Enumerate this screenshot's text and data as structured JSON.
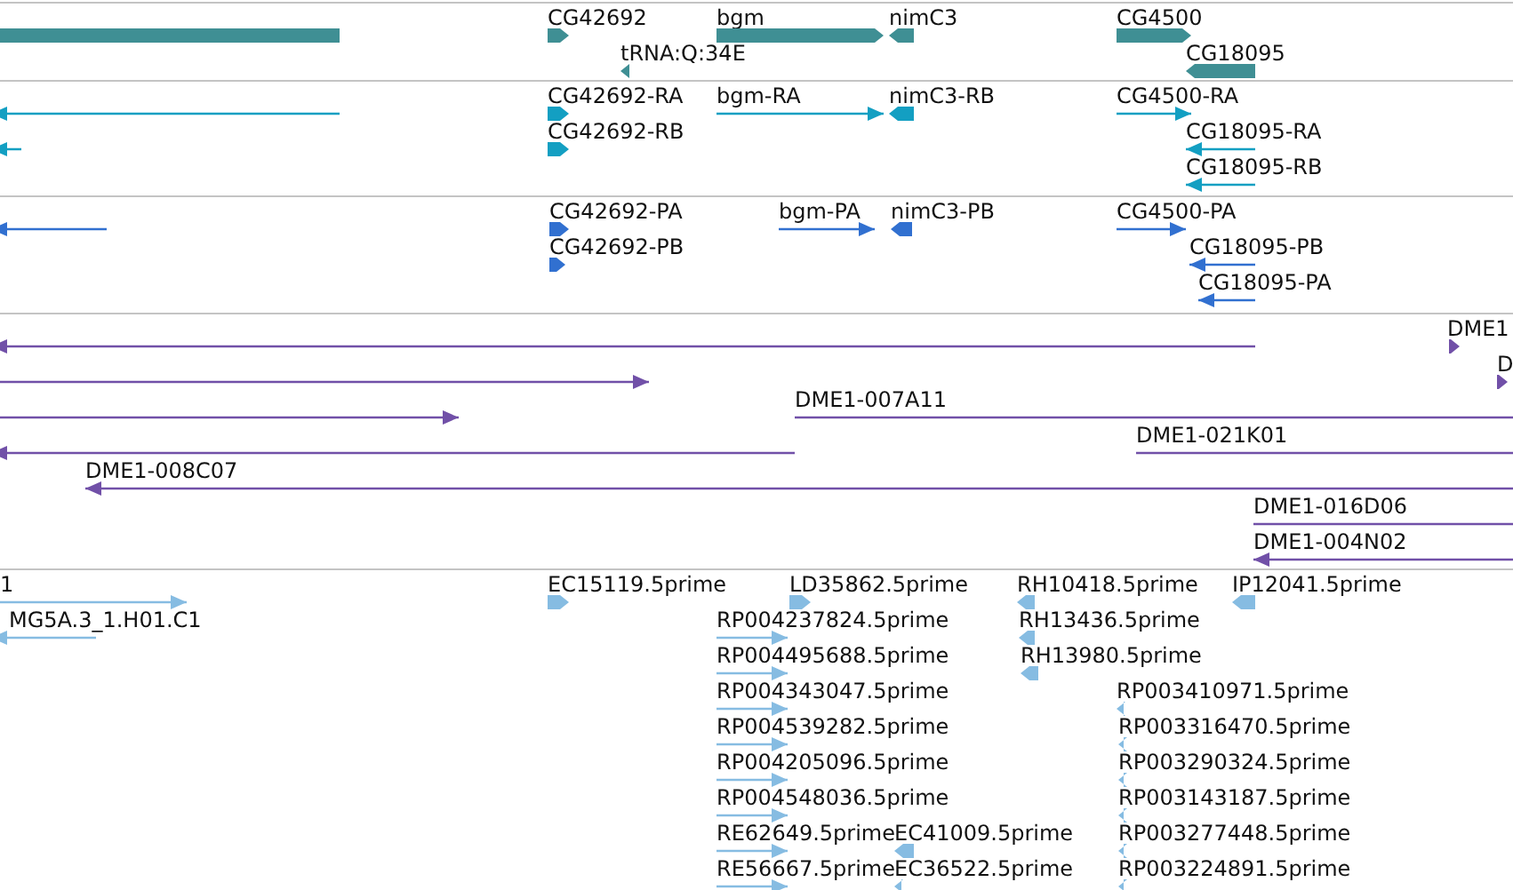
{
  "tracks": [
    {
      "color": "#3f8f94",
      "features": [
        {
          "kind": "block"
        },
        {
          "label": "CG42692",
          "kind": "forward"
        },
        {
          "label": "tRNA:Q:34E",
          "kind": "reverse"
        },
        {
          "label": "bgm",
          "kind": "forward"
        },
        {
          "label": "nimC3",
          "kind": "reverse"
        },
        {
          "label": "CG4500",
          "kind": "forward"
        },
        {
          "label": "CG18095",
          "kind": "reverse"
        }
      ]
    },
    {
      "color": "#139fc2",
      "features": [
        {
          "kind": "reverse"
        },
        {
          "kind": "reverse"
        },
        {
          "label": "CG42692-RA",
          "kind": "forward"
        },
        {
          "label": "CG42692-RB",
          "kind": "forward"
        },
        {
          "label": "bgm-RA",
          "kind": "forward"
        },
        {
          "label": "nimC3-RB",
          "kind": "reverse"
        },
        {
          "label": "CG4500-RA",
          "kind": "forward"
        },
        {
          "label": "CG18095-RA",
          "kind": "reverse"
        },
        {
          "label": "CG18095-RB",
          "kind": "reverse"
        }
      ]
    },
    {
      "color": "#3170d0",
      "features": [
        {
          "kind": "reverse"
        },
        {
          "label": "CG42692-PA",
          "kind": "forward"
        },
        {
          "label": "CG42692-PB",
          "kind": "forward"
        },
        {
          "label": "bgm-PA",
          "kind": "forward"
        },
        {
          "label": "nimC3-PB",
          "kind": "reverse"
        },
        {
          "label": "CG4500-PA",
          "kind": "forward"
        },
        {
          "label": "CG18095-PB",
          "kind": "reverse"
        },
        {
          "label": "CG18095-PA",
          "kind": "reverse"
        }
      ]
    },
    {
      "color": "#7150a8",
      "features": [
        {
          "kind": "reverse"
        },
        {
          "label": "DME1",
          "kind": "forward"
        },
        {
          "kind": "forward"
        },
        {
          "label": "D",
          "kind": "forward"
        },
        {
          "kind": "forward"
        },
        {
          "label": "DME1-007A11",
          "kind": "forward"
        },
        {
          "kind": "reverse"
        },
        {
          "label": "DME1-021K01",
          "kind": "forward"
        },
        {
          "label": "DME1-008C07",
          "kind": "reverse"
        },
        {
          "label": "DME1-016D06",
          "kind": "forward"
        },
        {
          "label": "DME1-004N02",
          "kind": "reverse"
        }
      ]
    },
    {
      "color": "#86bce2",
      "features": [
        {
          "label": "1",
          "kind": "forward"
        },
        {
          "label": "MG5A.3_1.H01.C1",
          "kind": "reverse"
        },
        {
          "label": "EC15119.5prime",
          "kind": "forward"
        },
        {
          "label": "LD35862.5prime",
          "kind": "forward"
        },
        {
          "label": "RH10418.5prime",
          "kind": "reverse"
        },
        {
          "label": "IP12041.5prime",
          "kind": "reverse"
        },
        {
          "label": "RP004237824.5prime",
          "kind": "forward"
        },
        {
          "label": "RH13436.5prime",
          "kind": "reverse"
        },
        {
          "label": "RP004495688.5prime",
          "kind": "forward"
        },
        {
          "label": "RH13980.5prime",
          "kind": "reverse"
        },
        {
          "label": "RP004343047.5prime",
          "kind": "forward"
        },
        {
          "label": "RP003410971.5prime",
          "kind": "reverse"
        },
        {
          "label": "RP004539282.5prime",
          "kind": "forward"
        },
        {
          "label": "RP003316470.5prime",
          "kind": "reverse"
        },
        {
          "label": "RP004205096.5prime",
          "kind": "forward"
        },
        {
          "label": "RP003290324.5prime",
          "kind": "reverse"
        },
        {
          "label": "RP004548036.5prime",
          "kind": "forward"
        },
        {
          "label": "RP003143187.5prime",
          "kind": "reverse"
        },
        {
          "label": "RE62649.5prime",
          "kind": "forward"
        },
        {
          "label": "EC41009.5prime",
          "kind": "reverse"
        },
        {
          "label": "RP003277448.5prime",
          "kind": "reverse"
        },
        {
          "label": "RE56667.5prime",
          "kind": "forward"
        },
        {
          "label": "EC36522.5prime",
          "kind": "reverse"
        },
        {
          "label": "RP003224891.5prime",
          "kind": "reverse"
        }
      ]
    }
  ]
}
